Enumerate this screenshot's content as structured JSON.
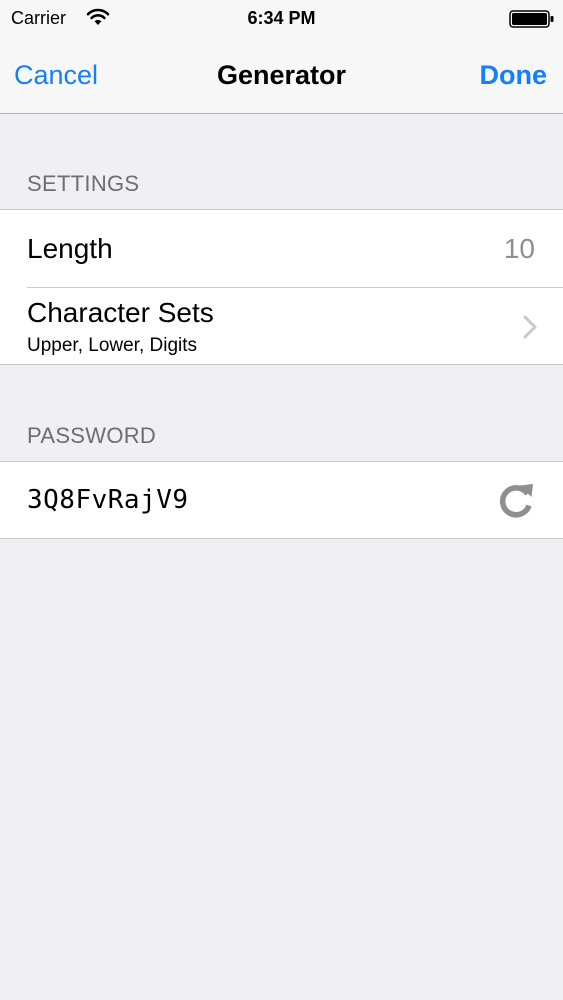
{
  "status_bar": {
    "carrier": "Carrier",
    "time": "6:34 PM",
    "icons": [
      "wifi-icon",
      "battery-icon"
    ]
  },
  "nav": {
    "cancel_label": "Cancel",
    "title": "Generator",
    "done_label": "Done"
  },
  "settings": {
    "header": "SETTINGS",
    "length_label": "Length",
    "length_value": "10",
    "charsets_label": "Character Sets",
    "charsets_value": "Upper, Lower, Digits",
    "charsets_icon": "chevron-right-icon"
  },
  "password": {
    "header": "PASSWORD",
    "value": "3Q8FvRajV9",
    "refresh_icon": "refresh-icon"
  },
  "colors": {
    "accent": "#157efb",
    "background": "#efeff4",
    "bar": "#f7f7f7",
    "section_text": "#6d6d72",
    "secondary_text": "#8e8e93",
    "separator": "#c8c7cc"
  }
}
